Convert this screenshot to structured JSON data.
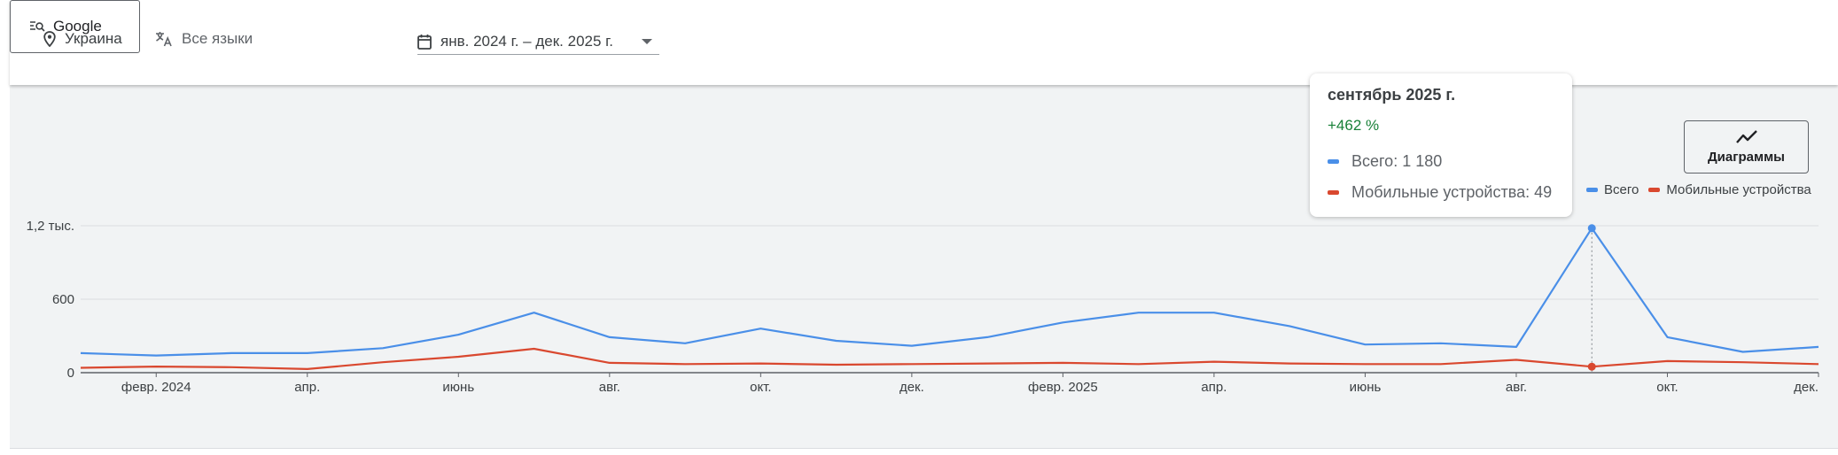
{
  "toolbar": {
    "location": "Украина",
    "language": "Все языки",
    "search_source": "Google",
    "date_range": "янв. 2024 г. – дек. 2025 г."
  },
  "chart_button": {
    "label": "Диаграммы"
  },
  "legend": {
    "total": "Всего",
    "mobile": "Мобильные устройства"
  },
  "colors": {
    "total": "#4a8fe8",
    "mobile": "#d9482f",
    "change_positive": "#188038"
  },
  "tooltip": {
    "title": "сентябрь 2025 г.",
    "change": "+462 %",
    "total_line": "Всего: 1 180",
    "mobile_line": "Мобильные устройства: 49"
  },
  "chart_data": {
    "type": "line",
    "y_ticks": [
      {
        "value": 0,
        "label": "0"
      },
      {
        "value": 600,
        "label": "600"
      },
      {
        "value": 1200,
        "label": "1,2 тыс."
      }
    ],
    "ylim": [
      0,
      1200
    ],
    "grid": true,
    "legend_position": "top-right",
    "x": [
      "янв. 2024",
      "февр. 2024",
      "март 2024",
      "апр. 2024",
      "май 2024",
      "июнь 2024",
      "июль 2024",
      "авг. 2024",
      "сент. 2024",
      "окт. 2024",
      "нояб. 2024",
      "дек. 2024",
      "янв. 2025",
      "февр. 2025",
      "март 2025",
      "апр. 2025",
      "май 2025",
      "июнь 2025",
      "июль 2025",
      "авг. 2025",
      "сент. 2025",
      "окт. 2025",
      "нояб. 2025",
      "дек. 2025"
    ],
    "x_tick_labels": [
      {
        "index": 1,
        "label": "февр. 2024"
      },
      {
        "index": 3,
        "label": "апр."
      },
      {
        "index": 5,
        "label": "июнь"
      },
      {
        "index": 7,
        "label": "авг."
      },
      {
        "index": 9,
        "label": "окт."
      },
      {
        "index": 11,
        "label": "дек."
      },
      {
        "index": 13,
        "label": "февр. 2025"
      },
      {
        "index": 15,
        "label": "апр."
      },
      {
        "index": 17,
        "label": "июнь"
      },
      {
        "index": 19,
        "label": "авг."
      },
      {
        "index": 21,
        "label": "окт."
      },
      {
        "index": 23,
        "label": "дек."
      }
    ],
    "series": [
      {
        "name": "Всего",
        "color": "#4a8fe8",
        "values": [
          160,
          140,
          160,
          160,
          200,
          310,
          490,
          290,
          240,
          360,
          260,
          220,
          290,
          410,
          490,
          490,
          380,
          230,
          240,
          210,
          1180,
          290,
          170,
          210
        ]
      },
      {
        "name": "Мобильные устройства",
        "color": "#d9482f",
        "values": [
          40,
          50,
          45,
          30,
          85,
          130,
          195,
          80,
          70,
          75,
          65,
          70,
          75,
          80,
          70,
          90,
          75,
          70,
          70,
          105,
          49,
          95,
          85,
          70
        ]
      }
    ],
    "highlight_index": 20
  }
}
